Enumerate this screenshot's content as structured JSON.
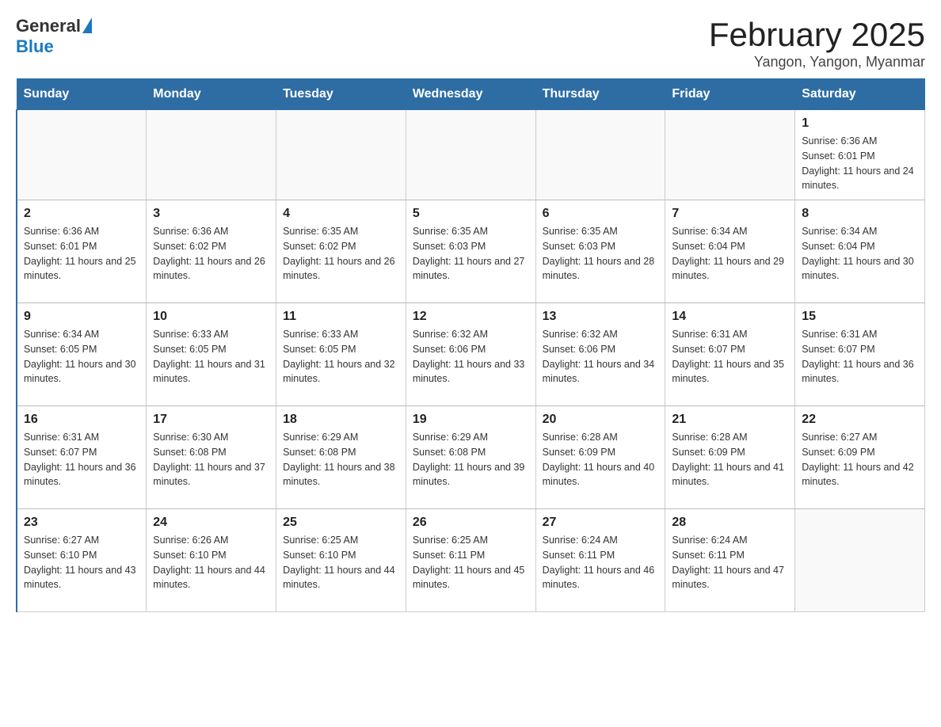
{
  "header": {
    "logo_general": "General",
    "logo_blue": "Blue",
    "month_title": "February 2025",
    "location": "Yangon, Yangon, Myanmar"
  },
  "days_of_week": [
    "Sunday",
    "Monday",
    "Tuesday",
    "Wednesday",
    "Thursday",
    "Friday",
    "Saturday"
  ],
  "weeks": [
    [
      {
        "day": "",
        "info": ""
      },
      {
        "day": "",
        "info": ""
      },
      {
        "day": "",
        "info": ""
      },
      {
        "day": "",
        "info": ""
      },
      {
        "day": "",
        "info": ""
      },
      {
        "day": "",
        "info": ""
      },
      {
        "day": "1",
        "info": "Sunrise: 6:36 AM\nSunset: 6:01 PM\nDaylight: 11 hours and 24 minutes."
      }
    ],
    [
      {
        "day": "2",
        "info": "Sunrise: 6:36 AM\nSunset: 6:01 PM\nDaylight: 11 hours and 25 minutes."
      },
      {
        "day": "3",
        "info": "Sunrise: 6:36 AM\nSunset: 6:02 PM\nDaylight: 11 hours and 26 minutes."
      },
      {
        "day": "4",
        "info": "Sunrise: 6:35 AM\nSunset: 6:02 PM\nDaylight: 11 hours and 26 minutes."
      },
      {
        "day": "5",
        "info": "Sunrise: 6:35 AM\nSunset: 6:03 PM\nDaylight: 11 hours and 27 minutes."
      },
      {
        "day": "6",
        "info": "Sunrise: 6:35 AM\nSunset: 6:03 PM\nDaylight: 11 hours and 28 minutes."
      },
      {
        "day": "7",
        "info": "Sunrise: 6:34 AM\nSunset: 6:04 PM\nDaylight: 11 hours and 29 minutes."
      },
      {
        "day": "8",
        "info": "Sunrise: 6:34 AM\nSunset: 6:04 PM\nDaylight: 11 hours and 30 minutes."
      }
    ],
    [
      {
        "day": "9",
        "info": "Sunrise: 6:34 AM\nSunset: 6:05 PM\nDaylight: 11 hours and 30 minutes."
      },
      {
        "day": "10",
        "info": "Sunrise: 6:33 AM\nSunset: 6:05 PM\nDaylight: 11 hours and 31 minutes."
      },
      {
        "day": "11",
        "info": "Sunrise: 6:33 AM\nSunset: 6:05 PM\nDaylight: 11 hours and 32 minutes."
      },
      {
        "day": "12",
        "info": "Sunrise: 6:32 AM\nSunset: 6:06 PM\nDaylight: 11 hours and 33 minutes."
      },
      {
        "day": "13",
        "info": "Sunrise: 6:32 AM\nSunset: 6:06 PM\nDaylight: 11 hours and 34 minutes."
      },
      {
        "day": "14",
        "info": "Sunrise: 6:31 AM\nSunset: 6:07 PM\nDaylight: 11 hours and 35 minutes."
      },
      {
        "day": "15",
        "info": "Sunrise: 6:31 AM\nSunset: 6:07 PM\nDaylight: 11 hours and 36 minutes."
      }
    ],
    [
      {
        "day": "16",
        "info": "Sunrise: 6:31 AM\nSunset: 6:07 PM\nDaylight: 11 hours and 36 minutes."
      },
      {
        "day": "17",
        "info": "Sunrise: 6:30 AM\nSunset: 6:08 PM\nDaylight: 11 hours and 37 minutes."
      },
      {
        "day": "18",
        "info": "Sunrise: 6:29 AM\nSunset: 6:08 PM\nDaylight: 11 hours and 38 minutes."
      },
      {
        "day": "19",
        "info": "Sunrise: 6:29 AM\nSunset: 6:08 PM\nDaylight: 11 hours and 39 minutes."
      },
      {
        "day": "20",
        "info": "Sunrise: 6:28 AM\nSunset: 6:09 PM\nDaylight: 11 hours and 40 minutes."
      },
      {
        "day": "21",
        "info": "Sunrise: 6:28 AM\nSunset: 6:09 PM\nDaylight: 11 hours and 41 minutes."
      },
      {
        "day": "22",
        "info": "Sunrise: 6:27 AM\nSunset: 6:09 PM\nDaylight: 11 hours and 42 minutes."
      }
    ],
    [
      {
        "day": "23",
        "info": "Sunrise: 6:27 AM\nSunset: 6:10 PM\nDaylight: 11 hours and 43 minutes."
      },
      {
        "day": "24",
        "info": "Sunrise: 6:26 AM\nSunset: 6:10 PM\nDaylight: 11 hours and 44 minutes."
      },
      {
        "day": "25",
        "info": "Sunrise: 6:25 AM\nSunset: 6:10 PM\nDaylight: 11 hours and 44 minutes."
      },
      {
        "day": "26",
        "info": "Sunrise: 6:25 AM\nSunset: 6:11 PM\nDaylight: 11 hours and 45 minutes."
      },
      {
        "day": "27",
        "info": "Sunrise: 6:24 AM\nSunset: 6:11 PM\nDaylight: 11 hours and 46 minutes."
      },
      {
        "day": "28",
        "info": "Sunrise: 6:24 AM\nSunset: 6:11 PM\nDaylight: 11 hours and 47 minutes."
      },
      {
        "day": "",
        "info": ""
      }
    ]
  ]
}
